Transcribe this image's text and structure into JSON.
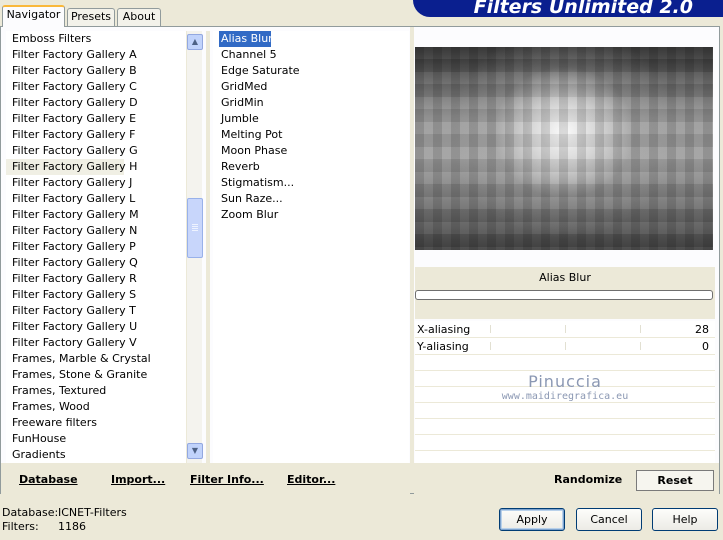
{
  "tabs": [
    {
      "label": "Navigator"
    },
    {
      "label": "Presets"
    },
    {
      "label": "About"
    }
  ],
  "banner_title": "Filters Unlimited 2.0",
  "categories": [
    "Emboss Filters",
    "Filter Factory Gallery A",
    "Filter Factory Gallery B",
    "Filter Factory Gallery C",
    "Filter Factory Gallery D",
    "Filter Factory Gallery E",
    "Filter Factory Gallery F",
    "Filter Factory Gallery G",
    "Filter Factory Gallery H",
    "Filter Factory Gallery J",
    "Filter Factory Gallery L",
    "Filter Factory Gallery M",
    "Filter Factory Gallery N",
    "Filter Factory Gallery P",
    "Filter Factory Gallery Q",
    "Filter Factory Gallery R",
    "Filter Factory Gallery S",
    "Filter Factory Gallery T",
    "Filter Factory Gallery U",
    "Filter Factory Gallery V",
    "Frames, Marble & Crystal",
    "Frames, Stone & Granite",
    "Frames, Textured",
    "Frames, Wood",
    "Freeware filters",
    "FunHouse",
    "Gradients"
  ],
  "selected_category": "Filter Factory Gallery H",
  "filters": [
    "Alias Blur",
    "Channel 5",
    "Edge Saturate",
    "GridMed",
    "GridMin",
    "Jumble",
    "Melting Pot",
    "Moon Phase",
    "Reverb",
    "Stigmatism...",
    "Sun Raze...",
    "Zoom Blur"
  ],
  "selected_filter": "Alias Blur",
  "filter_name": "Alias Blur",
  "params": [
    {
      "label": "X-aliasing",
      "value": "28"
    },
    {
      "label": "Y-aliasing",
      "value": "0"
    }
  ],
  "watermark": {
    "line1": "Pinuccia",
    "line2": "www.maidiregrafica.eu"
  },
  "toolbar": {
    "database": "Database",
    "import": "Import...",
    "filter_info": "Filter Info...",
    "editor": "Editor...",
    "randomize": "Randomize",
    "reset": "Reset"
  },
  "status": {
    "database_label": "Database:",
    "database_value": "ICNET-Filters",
    "filters_label": "Filters:",
    "filters_value": "1186"
  },
  "buttons": {
    "apply": "Apply",
    "cancel": "Cancel",
    "help": "Help"
  },
  "colors": {
    "banner": "#0a1f8f",
    "selection": "#316ac5",
    "tab_accent": "#f9b83a"
  }
}
